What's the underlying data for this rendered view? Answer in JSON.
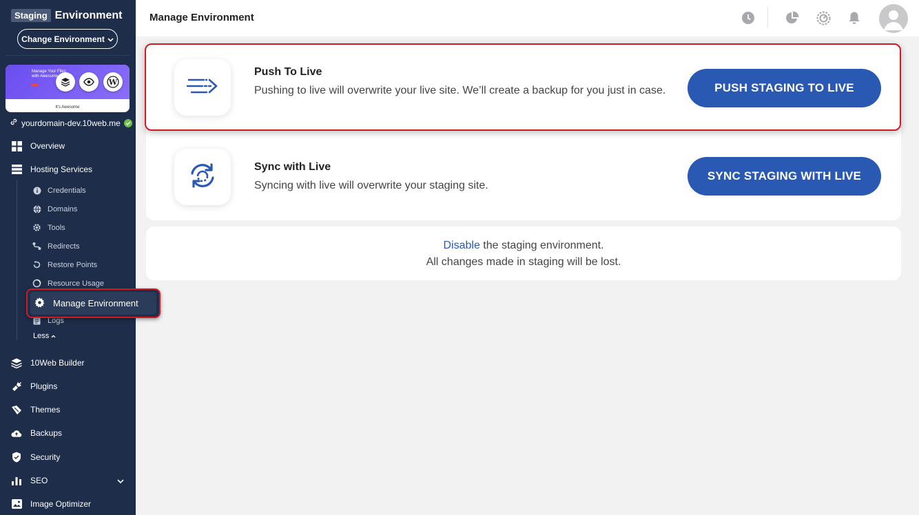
{
  "sidebar": {
    "env_badge": "Staging",
    "env_title": "Environment",
    "change_env_label": "Change Environment",
    "thumb_headline": "Manage Your Files with Awesome",
    "thumb_footer": "It's Awesome",
    "domain": "yourdomain-dev.10web.me",
    "nav": {
      "overview": "Overview",
      "hosting": "Hosting Services",
      "builder": "10Web Builder",
      "plugins": "Plugins",
      "themes": "Themes",
      "backups": "Backups",
      "security": "Security",
      "seo": "SEO",
      "image_optimizer": "Image Optimizer"
    },
    "sub": {
      "credentials": "Credentials",
      "domains": "Domains",
      "tools": "Tools",
      "redirects": "Redirects",
      "restore": "Restore Points",
      "resource": "Resource Usage",
      "manage_env": "Manage Environment",
      "logs": "Logs",
      "less": "Less"
    }
  },
  "header": {
    "title": "Manage Environment"
  },
  "push": {
    "title": "Push To Live",
    "description": "Pushing to live will overwrite your live site. We’ll create a backup for you just in case.",
    "button": "PUSH STAGING TO LIVE"
  },
  "sync": {
    "title": "Sync with Live",
    "description": "Syncing with live will overwrite your staging site.",
    "button": "SYNC STAGING WITH LIVE"
  },
  "disable": {
    "link": "Disable",
    "line1_rest": " the staging environment.",
    "line2": "All changes made in staging will be lost."
  },
  "colors": {
    "sidebar_bg": "#1e2d4a",
    "primary": "#2959b3",
    "highlight": "#d11b22",
    "success": "#6bc24a"
  },
  "icons": [
    "layers-icon",
    "eye-icon",
    "wordpress-icon",
    "link-icon",
    "check-icon",
    "grid-icon",
    "server-icon",
    "info-icon",
    "globe-icon",
    "gear-icon",
    "redirect-icon",
    "restore-icon",
    "usage-icon",
    "logs-icon",
    "layers-icon",
    "plug-icon",
    "brush-icon",
    "cloud-icon",
    "shield-icon",
    "chart-icon",
    "image-icon",
    "clock-icon",
    "pie-icon",
    "speed-icon",
    "bell-icon",
    "avatar",
    "push-icon",
    "sync-icon"
  ]
}
